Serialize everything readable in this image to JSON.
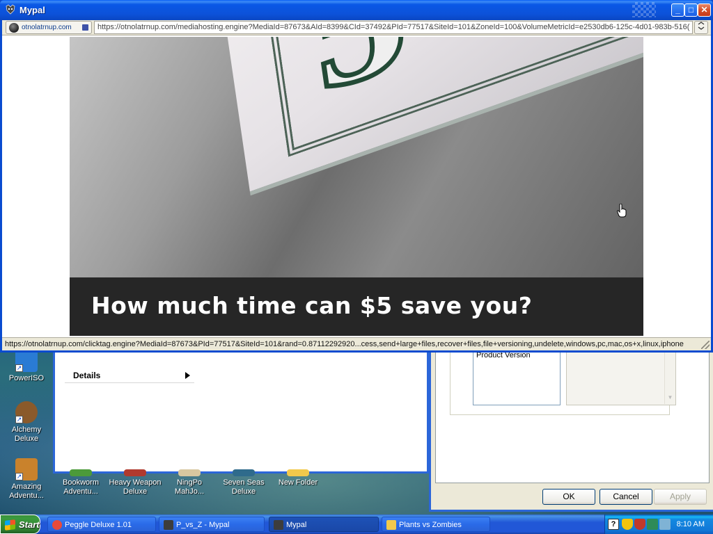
{
  "browser": {
    "title": "Mypal",
    "site_identity": "otnolatrnup.com",
    "url": "https://otnolatrnup.com/mediahosting.engine?MediaId=87673&AId=8399&CId=37492&PId=77517&SiteId=101&ZoneId=100&VolumeMetricId=e2530db6-125c-4d01-983b-516(",
    "status_text": "https://otnolatrnup.com/clicktag.engine?MediaId=87673&PId=77517&SiteId=101&rand=0.87112292920...cess,send+large+files,recover+files,file+versioning,undelete,windows,pc,mac,os+x,linux,iphone",
    "ad_headline": "How much time can $5 save you?",
    "ad_bill_digit": "5"
  },
  "background_windows": {
    "details_label": "Details",
    "product_version_label": "Product Version",
    "ok_label": "OK",
    "cancel_label": "Cancel",
    "apply_label": "Apply"
  },
  "desktop_icons": [
    {
      "label": "PowerISO",
      "icon": "poweriso-icon",
      "color": "#2a7bd4"
    },
    {
      "label": "Alchemy Deluxe",
      "icon": "alchemy-icon",
      "color": "#8a5a2b"
    },
    {
      "label": "Amazing Adventu...",
      "icon": "amazing-adventures-icon",
      "color": "#c9822c"
    },
    {
      "label": "Bookworm Adventu...",
      "icon": "bookworm-icon",
      "color": "#4c9a3a"
    },
    {
      "label": "Heavy Weapon Deluxe",
      "icon": "heavy-weapon-icon",
      "color": "#b03a2e"
    },
    {
      "label": "NingPo MahJo...",
      "icon": "mahjong-icon",
      "color": "#d8c7a0"
    },
    {
      "label": "Seven Seas Deluxe",
      "icon": "seven-seas-icon",
      "color": "#2f6b8c"
    },
    {
      "label": "New Folder",
      "icon": "folder-icon",
      "color": "#f2c94c"
    }
  ],
  "taskbar": {
    "start_label": "Start",
    "tasks": [
      {
        "label": "Peggle Deluxe 1.01",
        "icon": "peggle-icon",
        "color": "#e84a3a"
      },
      {
        "label": "P_vs_Z - Mypal",
        "icon": "mypal-icon",
        "color": "#3d3d3d"
      },
      {
        "label": "Mypal",
        "icon": "mypal-icon",
        "color": "#3d3d3d",
        "active": true
      },
      {
        "label": "Plants vs Zombies",
        "icon": "folder-icon",
        "color": "#f2c94c"
      }
    ],
    "clock": "8:10 AM"
  },
  "colors": {
    "titlebar": "#0a58e6",
    "taskbar": "#2157d7",
    "start_green": "#3c9c3e",
    "ad_banner": "#262626"
  }
}
